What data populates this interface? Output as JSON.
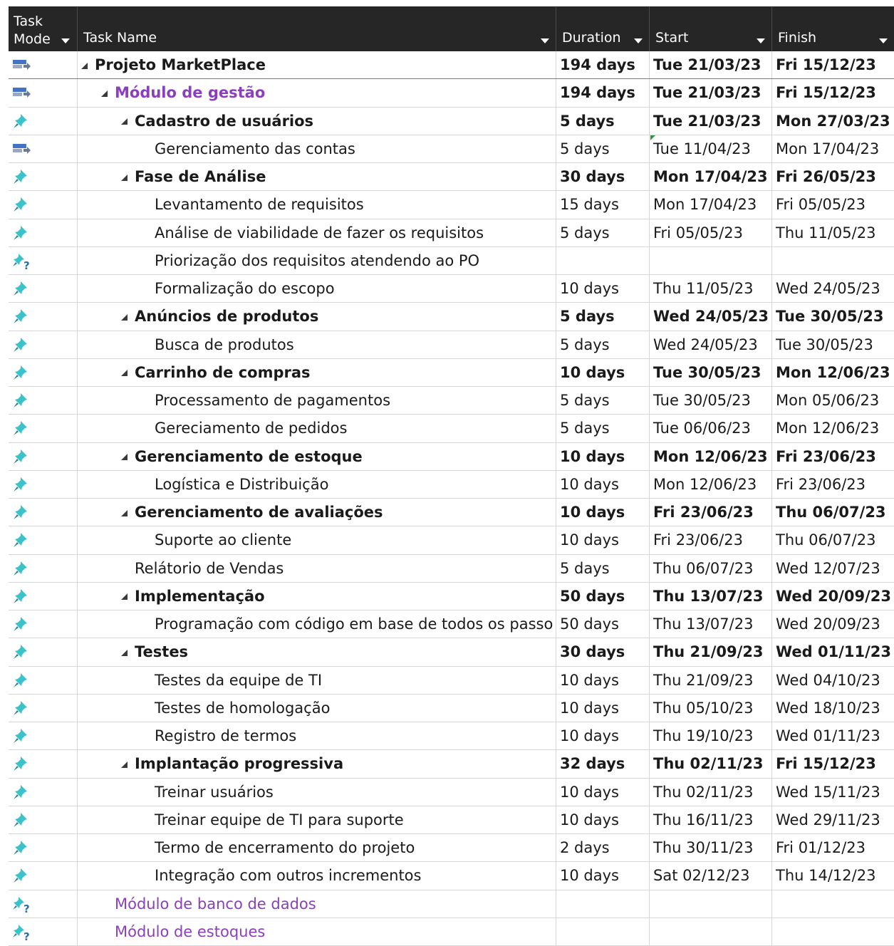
{
  "header": {
    "mode": "Task\nMode",
    "name": "Task Name",
    "duration": "Duration",
    "start": "Start",
    "finish": "Finish"
  },
  "colors": {
    "manual_icon": "#4472c4",
    "auto_icon": "#3cc3c9",
    "purple_text": "#8b3fbf",
    "header_bg": "#262626"
  },
  "rows": [
    {
      "icon": "manual-task-icon",
      "level": 0,
      "summary": true,
      "bold": true,
      "purple": false,
      "name": "Projeto MarketPlace",
      "duration": "194 days",
      "start": "Tue 21/03/23",
      "finish": "Fri 15/12/23"
    },
    {
      "icon": "manual-task-icon",
      "level": 1,
      "summary": true,
      "bold": true,
      "purple": true,
      "name": "Módulo de gestão",
      "duration": "194 days",
      "start": "Tue 21/03/23",
      "finish": "Fri 15/12/23"
    },
    {
      "icon": "auto-task-icon",
      "level": 2,
      "summary": true,
      "bold": true,
      "purple": false,
      "name": "Cadastro de usuários",
      "duration": "5 days",
      "start": "Tue 21/03/23",
      "finish": "Mon 27/03/23"
    },
    {
      "icon": "manual-task-icon",
      "level": 3,
      "summary": false,
      "bold": false,
      "purple": false,
      "flag": true,
      "name": "Gerenciamento das contas",
      "duration": "5 days",
      "start": "Tue 11/04/23",
      "finish": "Mon 17/04/23"
    },
    {
      "icon": "auto-task-icon",
      "level": 2,
      "summary": true,
      "bold": true,
      "purple": false,
      "name": "Fase de Análise",
      "duration": "30 days",
      "start": "Mon 17/04/23",
      "finish": "Fri 26/05/23"
    },
    {
      "icon": "auto-task-icon",
      "level": 3,
      "summary": false,
      "bold": false,
      "purple": false,
      "name": "Levantamento de requisitos",
      "duration": "15 days",
      "start": "Mon 17/04/23",
      "finish": "Fri 05/05/23"
    },
    {
      "icon": "auto-task-icon",
      "level": 3,
      "summary": false,
      "bold": false,
      "purple": false,
      "name": "Análise de viabilidade de fazer os requisitos",
      "duration": "5 days",
      "start": "Fri 05/05/23",
      "finish": "Thu 11/05/23"
    },
    {
      "icon": "unscheduled-task-icon",
      "level": 3,
      "summary": false,
      "bold": false,
      "purple": false,
      "name": "Priorização dos requisitos atendendo ao PO",
      "duration": "",
      "start": "",
      "finish": ""
    },
    {
      "icon": "auto-task-icon",
      "level": 3,
      "summary": false,
      "bold": false,
      "purple": false,
      "name": "Formalização do escopo",
      "duration": "10 days",
      "start": "Thu 11/05/23",
      "finish": "Wed 24/05/23"
    },
    {
      "icon": "auto-task-icon",
      "level": 2,
      "summary": true,
      "bold": true,
      "purple": false,
      "name": "Anúncios de produtos",
      "duration": "5 days",
      "start": "Wed 24/05/23",
      "finish": "Tue 30/05/23"
    },
    {
      "icon": "auto-task-icon",
      "level": 3,
      "summary": false,
      "bold": false,
      "purple": false,
      "name": "Busca de produtos",
      "duration": "5 days",
      "start": "Wed 24/05/23",
      "finish": "Tue 30/05/23"
    },
    {
      "icon": "auto-task-icon",
      "level": 2,
      "summary": true,
      "bold": true,
      "purple": false,
      "name": "Carrinho de compras",
      "duration": "10 days",
      "start": "Tue 30/05/23",
      "finish": "Mon 12/06/23"
    },
    {
      "icon": "auto-task-icon",
      "level": 3,
      "summary": false,
      "bold": false,
      "purple": false,
      "name": "Processamento de pagamentos",
      "duration": "5 days",
      "start": "Tue 30/05/23",
      "finish": "Mon 05/06/23"
    },
    {
      "icon": "auto-task-icon",
      "level": 3,
      "summary": false,
      "bold": false,
      "purple": false,
      "name": "Gereciamento de pedidos",
      "duration": "5 days",
      "start": "Tue 06/06/23",
      "finish": "Mon 12/06/23"
    },
    {
      "icon": "auto-task-icon",
      "level": 2,
      "summary": true,
      "bold": true,
      "purple": false,
      "name": "Gerenciamento de estoque",
      "duration": "10 days",
      "start": "Mon 12/06/23",
      "finish": "Fri 23/06/23"
    },
    {
      "icon": "auto-task-icon",
      "level": 3,
      "summary": false,
      "bold": false,
      "purple": false,
      "name": "Logística e Distribuição",
      "duration": "10 days",
      "start": "Mon 12/06/23",
      "finish": "Fri 23/06/23"
    },
    {
      "icon": "auto-task-icon",
      "level": 2,
      "summary": true,
      "bold": true,
      "purple": false,
      "name": "Gerenciamento de avaliações",
      "duration": "10 days",
      "start": "Fri 23/06/23",
      "finish": "Thu 06/07/23"
    },
    {
      "icon": "auto-task-icon",
      "level": 3,
      "summary": false,
      "bold": false,
      "purple": false,
      "name": "Suporte ao cliente",
      "duration": "10 days",
      "start": "Fri 23/06/23",
      "finish": "Thu 06/07/23"
    },
    {
      "icon": "auto-task-icon",
      "level": 2,
      "summary": false,
      "bold": false,
      "purple": false,
      "name": "Relátorio de Vendas",
      "duration": "5 days",
      "start": "Thu 06/07/23",
      "finish": "Wed 12/07/23"
    },
    {
      "icon": "auto-task-icon",
      "level": 2,
      "summary": true,
      "bold": true,
      "purple": false,
      "name": "Implementação",
      "duration": "50 days",
      "start": "Thu 13/07/23",
      "finish": "Wed 20/09/23"
    },
    {
      "icon": "auto-task-icon",
      "level": 3,
      "summary": false,
      "bold": false,
      "purple": false,
      "name": "Programação com código em base de todos os passo",
      "duration": "50 days",
      "start": "Thu 13/07/23",
      "finish": "Wed 20/09/23"
    },
    {
      "icon": "auto-task-icon",
      "level": 2,
      "summary": true,
      "bold": true,
      "purple": false,
      "name": "Testes",
      "duration": "30 days",
      "start": "Thu 21/09/23",
      "finish": "Wed 01/11/23"
    },
    {
      "icon": "auto-task-icon",
      "level": 3,
      "summary": false,
      "bold": false,
      "purple": false,
      "name": "Testes da equipe de TI",
      "duration": "10 days",
      "start": "Thu 21/09/23",
      "finish": "Wed 04/10/23"
    },
    {
      "icon": "auto-task-icon",
      "level": 3,
      "summary": false,
      "bold": false,
      "purple": false,
      "name": "Testes de homologação",
      "duration": "10 days",
      "start": "Thu 05/10/23",
      "finish": "Wed 18/10/23"
    },
    {
      "icon": "auto-task-icon",
      "level": 3,
      "summary": false,
      "bold": false,
      "purple": false,
      "name": "Registro de termos",
      "duration": "10 days",
      "start": "Thu 19/10/23",
      "finish": "Wed 01/11/23"
    },
    {
      "icon": "auto-task-icon",
      "level": 2,
      "summary": true,
      "bold": true,
      "purple": false,
      "name": "Implantação progressiva",
      "duration": "32 days",
      "start": "Thu 02/11/23",
      "finish": "Fri 15/12/23"
    },
    {
      "icon": "auto-task-icon",
      "level": 3,
      "summary": false,
      "bold": false,
      "purple": false,
      "name": "Treinar usuários",
      "duration": "10 days",
      "start": "Thu 02/11/23",
      "finish": "Wed 15/11/23"
    },
    {
      "icon": "auto-task-icon",
      "level": 3,
      "summary": false,
      "bold": false,
      "purple": false,
      "name": "Treinar equipe de TI para suporte",
      "duration": "10 days",
      "start": "Thu 16/11/23",
      "finish": "Wed 29/11/23"
    },
    {
      "icon": "auto-task-icon",
      "level": 3,
      "summary": false,
      "bold": false,
      "purple": false,
      "name": "Termo de encerramento do projeto",
      "duration": "2 days",
      "start": "Thu 30/11/23",
      "finish": "Fri 01/12/23"
    },
    {
      "icon": "auto-task-icon",
      "level": 3,
      "summary": false,
      "bold": false,
      "purple": false,
      "name": "Integração com outros incrementos",
      "duration": "10 days",
      "start": "Sat 02/12/23",
      "finish": "Thu 14/12/23"
    },
    {
      "icon": "unscheduled-task-icon",
      "level": 1,
      "summary": false,
      "bold": false,
      "purple": true,
      "name": "Módulo de banco de dados",
      "duration": "",
      "start": "",
      "finish": ""
    },
    {
      "icon": "unscheduled-task-icon",
      "level": 1,
      "summary": false,
      "bold": false,
      "purple": true,
      "name": "Módulo de estoques",
      "duration": "",
      "start": "",
      "finish": ""
    }
  ]
}
